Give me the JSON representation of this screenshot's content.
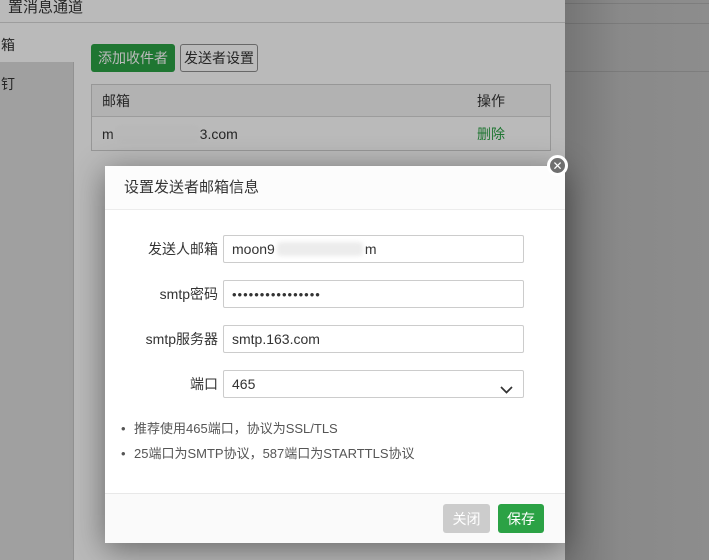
{
  "window": {
    "header_title_partial": "置消息通道"
  },
  "sidebar": {
    "items": [
      {
        "label": "箱",
        "selected": true
      },
      {
        "label": "钉",
        "selected": false
      }
    ]
  },
  "toolbar": {
    "add_recipient_label": "添加收件者",
    "sender_settings_label": "发送者设置"
  },
  "recipients_table": {
    "columns": {
      "email": "邮箱",
      "action": "操作"
    },
    "rows": [
      {
        "email_visible_prefix": "m",
        "email_visible_suffix": "3.com",
        "email_redacted": true,
        "action_label": "删除"
      }
    ]
  },
  "modal": {
    "title": "设置发送者邮箱信息",
    "close_icon": "✕",
    "fields": [
      {
        "label": "发送人邮箱",
        "visible_prefix": "moon9",
        "visible_suffix": "m",
        "redacted": true
      },
      {
        "label": "smtp密码",
        "value": "••••••••••••••••"
      },
      {
        "label": "smtp服务器",
        "value": "smtp.163.com"
      },
      {
        "label": "端口",
        "value": "465"
      }
    ],
    "notes": [
      "推荐使用465端口，协议为SSL/TLS",
      "25端口为SMTP协议，587端口为STARTTLS协议"
    ],
    "footer": {
      "close_label": "关闭",
      "save_label": "保存"
    }
  },
  "colors": {
    "accent_green": "#2BA245",
    "delete_link_green": "#2BA245",
    "close_button_gray": "#cccccc"
  }
}
